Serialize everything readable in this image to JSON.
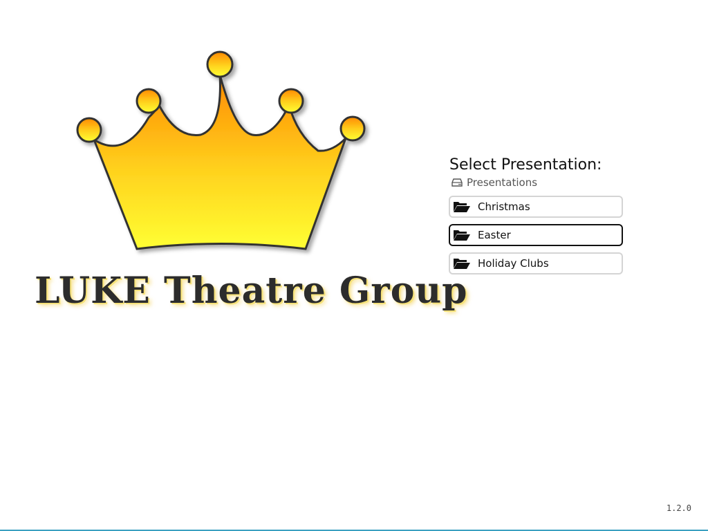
{
  "logo": {
    "text": "LUKE Theatre Group",
    "crown_colors": {
      "top": "#ff8a00",
      "bottom": "#ffff33",
      "outline": "#333333"
    }
  },
  "selector": {
    "title": "Select Presentation:",
    "breadcrumb": {
      "icon": "drive-icon",
      "label": "Presentations"
    },
    "items": [
      {
        "label": "Christmas",
        "icon": "folder-open-icon",
        "focused": false
      },
      {
        "label": "Easter",
        "icon": "folder-open-icon",
        "focused": true
      },
      {
        "label": "Holiday Clubs",
        "icon": "folder-open-icon",
        "focused": false
      }
    ]
  },
  "version": "1.2.0",
  "colors": {
    "background": "#ffffff",
    "focus_border": "#111111",
    "button_border": "#d4d4d4",
    "bottom_line": "#3aa0c0"
  }
}
